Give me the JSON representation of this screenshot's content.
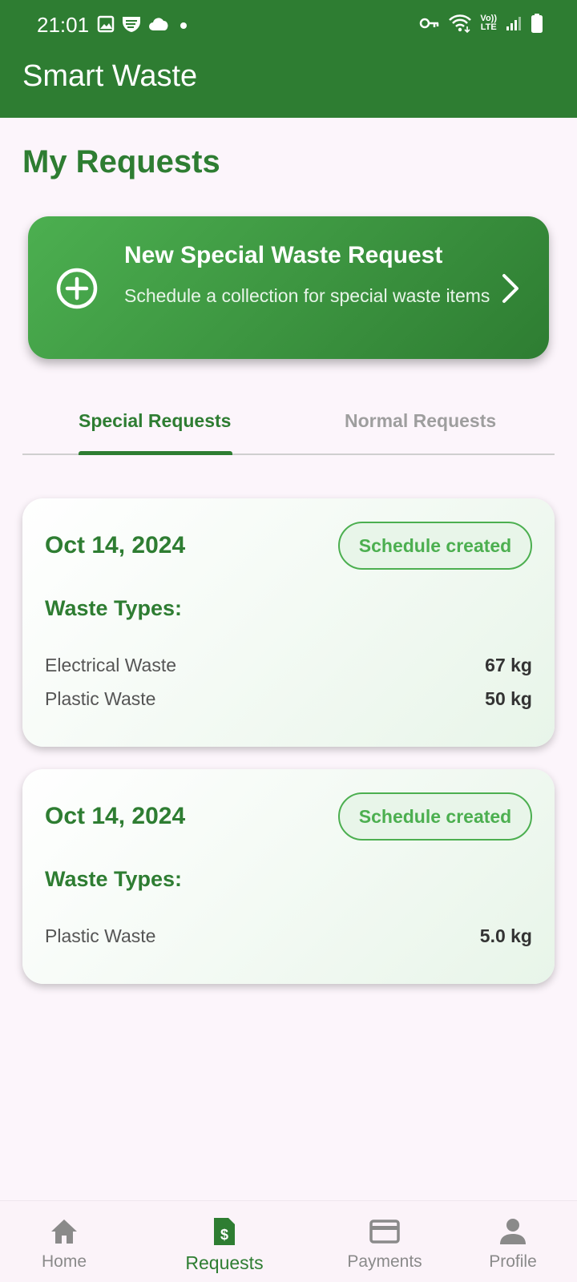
{
  "status_bar": {
    "time": "21:01",
    "left_icons": [
      "gallery-icon",
      "app-icon",
      "cloud-icon",
      "dot-icon"
    ],
    "right_icons": [
      "key-icon",
      "wifi-icon",
      "volte-icon",
      "signal-icon",
      "battery-icon"
    ],
    "volte_text_top": "Vo))",
    "volte_text_bottom": "LTE"
  },
  "app_bar": {
    "title": "Smart Waste"
  },
  "page": {
    "title": "My Requests"
  },
  "new_request_card": {
    "title": "New Special Waste Request",
    "subtitle": "Schedule a collection for special waste items",
    "icon": "add-circle-icon",
    "chevron": "chevron-right-icon"
  },
  "tabs": [
    {
      "label": "Special Requests",
      "active": true
    },
    {
      "label": "Normal Requests",
      "active": false
    }
  ],
  "requests": [
    {
      "date": "Oct 14, 2024",
      "status": "Schedule created",
      "waste_types_label": "Waste Types:",
      "items": [
        {
          "name": "Electrical Waste",
          "qty": "67 kg"
        },
        {
          "name": "Plastic Waste",
          "qty": "50 kg"
        }
      ]
    },
    {
      "date": "Oct 14, 2024",
      "status": "Schedule created",
      "waste_types_label": "Waste Types:",
      "items": [
        {
          "name": "Plastic Waste",
          "qty": "5.0 kg"
        }
      ]
    }
  ],
  "bottom_nav": [
    {
      "label": "Home",
      "icon": "home-icon",
      "active": false
    },
    {
      "label": "Requests",
      "icon": "requests-icon",
      "active": true
    },
    {
      "label": "Payments",
      "icon": "card-icon",
      "active": false
    },
    {
      "label": "Profile",
      "icon": "person-icon",
      "active": false
    }
  ],
  "colors": {
    "primary": "#2e7d32",
    "accent": "#4caf50",
    "background": "#fcf5fb",
    "inactive": "#8a8a8a"
  }
}
